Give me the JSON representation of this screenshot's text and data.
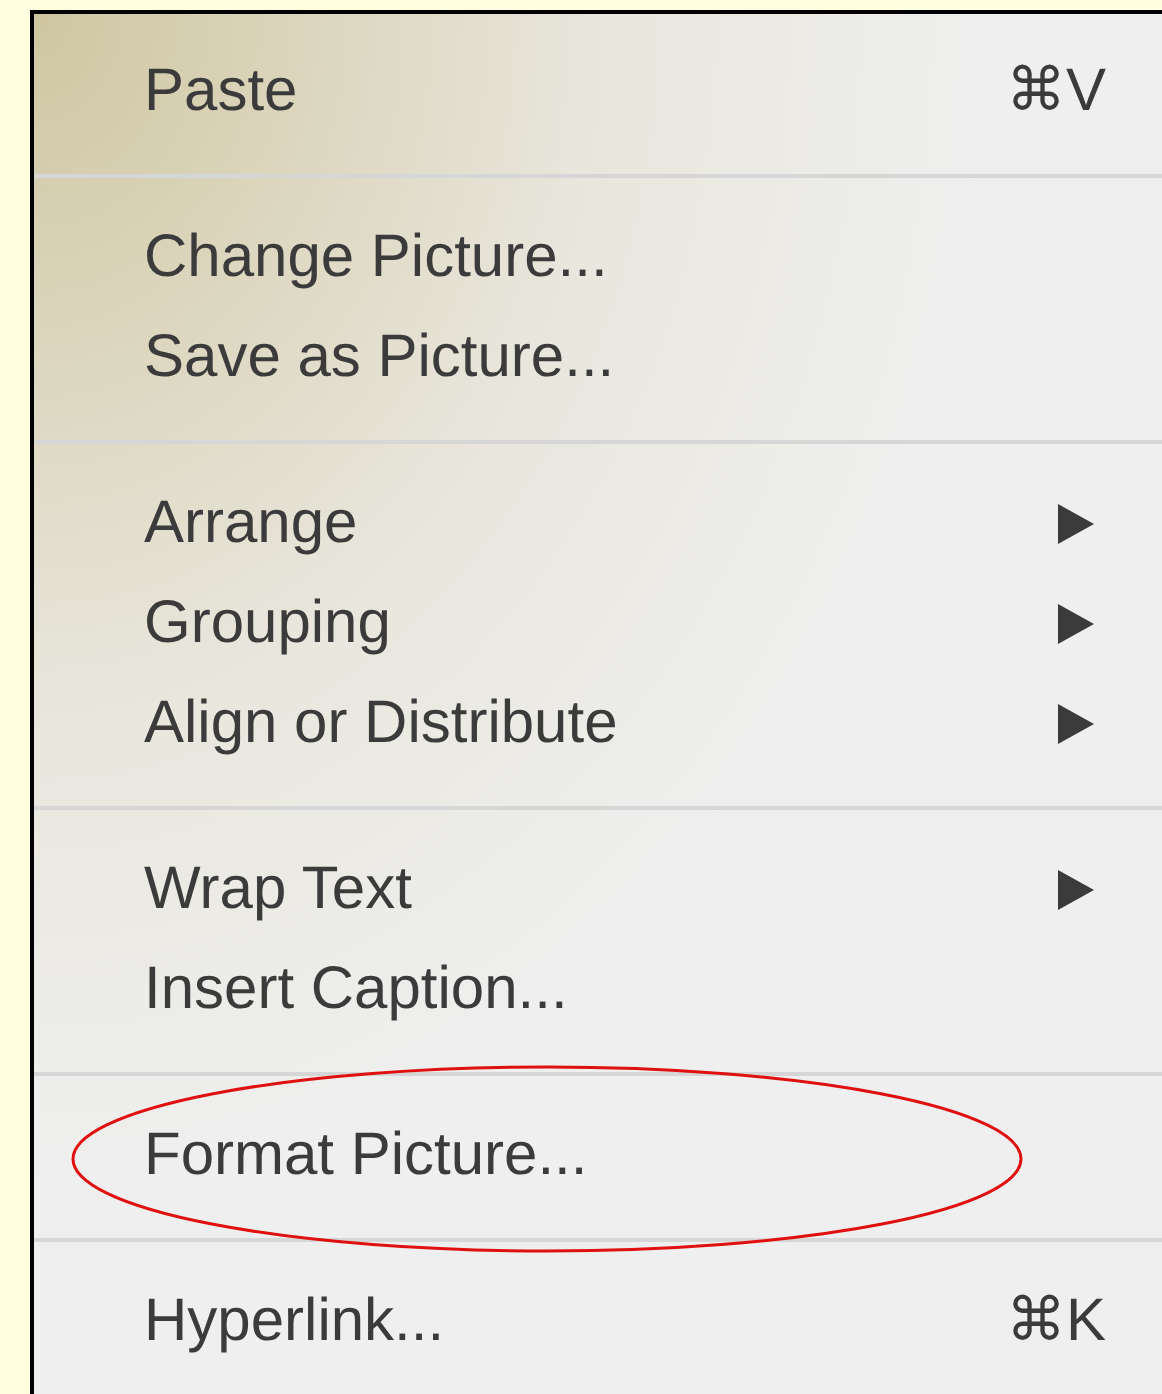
{
  "menu": {
    "sections": [
      {
        "items": [
          {
            "label": "Paste",
            "shortcut": "⌘V",
            "has_submenu": false,
            "circled": false
          }
        ]
      },
      {
        "items": [
          {
            "label": "Change Picture...",
            "has_submenu": false,
            "circled": false
          },
          {
            "label": "Save as Picture...",
            "has_submenu": false,
            "circled": false
          }
        ]
      },
      {
        "items": [
          {
            "label": "Arrange",
            "has_submenu": true,
            "circled": false
          },
          {
            "label": "Grouping",
            "has_submenu": true,
            "circled": false
          },
          {
            "label": "Align or Distribute",
            "has_submenu": true,
            "circled": false
          }
        ]
      },
      {
        "items": [
          {
            "label": "Wrap Text",
            "has_submenu": true,
            "circled": false
          },
          {
            "label": "Insert Caption...",
            "has_submenu": false,
            "circled": false
          }
        ]
      },
      {
        "items": [
          {
            "label": "Format Picture...",
            "has_submenu": false,
            "circled": true
          }
        ]
      },
      {
        "items": [
          {
            "label": "Hyperlink...",
            "shortcut": "⌘K",
            "has_submenu": false,
            "circled": false
          }
        ]
      }
    ]
  }
}
